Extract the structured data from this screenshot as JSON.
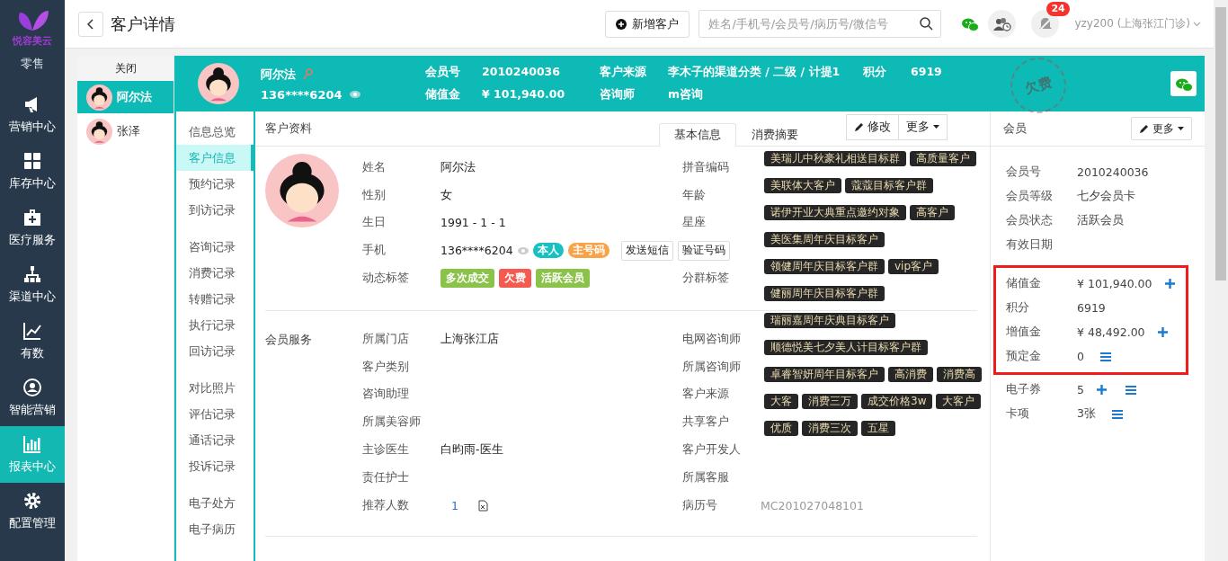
{
  "sidebar": {
    "logo": "悦容美云",
    "items": [
      {
        "label": "零售",
        "selected": false
      },
      {
        "label": "营销中心",
        "selected": false
      },
      {
        "label": "库存中心",
        "selected": false
      },
      {
        "label": "医疗服务",
        "selected": false
      },
      {
        "label": "渠道中心",
        "selected": false
      },
      {
        "label": "有数",
        "selected": false
      },
      {
        "label": "智能营销",
        "selected": false
      },
      {
        "label": "报表中心",
        "selected": true
      },
      {
        "label": "配置管理",
        "selected": false
      }
    ]
  },
  "header": {
    "title": "客户详情",
    "add_button": "新增客户",
    "search": {
      "placeholder": "姓名/手机号/会员号/病历号/微信号"
    },
    "notification_count": "24",
    "user": "yzy200 (上海张江门诊)"
  },
  "customer_tabs": {
    "close": "关闭",
    "items": [
      {
        "name": "阿尔法",
        "selected": true
      },
      {
        "name": "张泽",
        "selected": false
      }
    ]
  },
  "customer_header": {
    "name": "阿尔法",
    "phone": "136****6204",
    "stamp": "欠费",
    "fields": [
      {
        "label": "会员号",
        "value": "2010240036"
      },
      {
        "label": "客户来源",
        "value": "李木子的渠道分类 / 二级 / 计提1"
      },
      {
        "label": "积分",
        "value": "6919"
      },
      {
        "label": "储值金",
        "value": "¥ 101,940.00"
      },
      {
        "label": "咨询师",
        "value": "m咨询"
      }
    ]
  },
  "nav": {
    "groups": [
      [
        {
          "label": "信息总览",
          "selected": false
        },
        {
          "label": "客户信息",
          "selected": true
        },
        {
          "label": "预约记录",
          "selected": false
        },
        {
          "label": "到访记录",
          "selected": false
        }
      ],
      [
        {
          "label": "咨询记录",
          "selected": false
        },
        {
          "label": "消费记录",
          "selected": false
        },
        {
          "label": "转赠记录",
          "selected": false
        },
        {
          "label": "执行记录",
          "selected": false
        },
        {
          "label": "回访记录",
          "selected": false
        }
      ],
      [
        {
          "label": "对比照片",
          "selected": false
        },
        {
          "label": "评估记录",
          "selected": false
        },
        {
          "label": "通话记录",
          "selected": false
        },
        {
          "label": "投诉记录",
          "selected": false
        }
      ],
      [
        {
          "label": "电子处方",
          "selected": false
        },
        {
          "label": "电子病历",
          "selected": false
        }
      ]
    ]
  },
  "profile": {
    "title": "客户资料",
    "tabs": [
      {
        "label": "基本信息",
        "selected": true
      },
      {
        "label": "消费摘要",
        "selected": false
      }
    ],
    "edit_button": "修改",
    "more_button": "更多",
    "sections": [
      {
        "kind": "basic",
        "left": [
          {
            "label": "姓名",
            "kind": "text",
            "value": "阿尔法"
          },
          {
            "label": "性别",
            "kind": "text",
            "value": "女"
          },
          {
            "label": "生日",
            "kind": "text",
            "value": "1991 - 1 - 1"
          },
          {
            "label": "手机",
            "kind": "phone",
            "value": "136****6204",
            "tags": [
              {
                "text": "本人",
                "color": "#19c0c2"
              },
              {
                "text": "主号码",
                "color": "#f8a348"
              }
            ],
            "buttons": [
              "发送短信",
              "验证号码"
            ]
          },
          {
            "label": "动态标签",
            "kind": "tags",
            "tags": [
              {
                "text": "多次成交",
                "color": "#8bc34a"
              },
              {
                "text": "欠费",
                "color": "#f45b50"
              },
              {
                "text": "活跃会员",
                "color": "#8bc34a"
              }
            ]
          }
        ],
        "right": [
          {
            "label": "拼音编码",
            "kind": "text"
          },
          {
            "label": "年龄",
            "kind": "text"
          },
          {
            "label": "星座",
            "kind": "text"
          },
          {
            "label": "分群标签",
            "kind": "groups",
            "rows": [
              {
                "tags": [
                  "美瑞儿中秋豪礼相送目标群",
                  "高质量客户"
                ]
              },
              {
                "tags": [
                  "美联体大客户",
                  "蔻蔻目标客户群"
                ]
              },
              {
                "tags": [
                  "诺伊开业大典重点邀约对象",
                  "高客户"
                ]
              },
              {
                "tags": [
                  "美医集周年庆目标客户"
                ]
              },
              {
                "tags": [
                  "领健周年庆目标客户群",
                  "vip客户"
                ]
              },
              {
                "tags": [
                  "健丽周年庆目标客户群"
                ]
              },
              {
                "tags": [
                  "瑞丽嘉周年庆典目标客户"
                ]
              },
              {
                "tags": [
                  "顺德悦美七夕美人计目标客户群"
                ]
              },
              {
                "tags": [
                  "卓睿智妍周年目标客户",
                  "高消费",
                  "消费高"
                ]
              },
              {
                "tags": [
                  "大客",
                  "消费三万",
                  "成交价格3w",
                  "大客户"
                ]
              },
              {
                "tags": [
                  "优质",
                  "消费三次",
                  "五星"
                ]
              }
            ]
          }
        ]
      },
      {
        "kind": "service",
        "title": "会员服务",
        "left": [
          {
            "label": "所属门店",
            "kind": "text",
            "value": "上海张江店"
          },
          {
            "label": "客户类别",
            "kind": "text"
          },
          {
            "label": "咨询助理",
            "kind": "text"
          },
          {
            "label": "所属美容师",
            "kind": "text"
          },
          {
            "label": "主诊医生",
            "kind": "text",
            "value": "白昀雨-医生"
          },
          {
            "label": "责任护士",
            "kind": "text"
          },
          {
            "label": "推荐人数",
            "kind": "count",
            "value": "1"
          }
        ],
        "right": [
          {
            "label": "电网咨询师",
            "kind": "text"
          },
          {
            "label": "所属咨询师",
            "kind": "text"
          },
          {
            "label": "客户来源",
            "kind": "text"
          },
          {
            "label": "共享客户",
            "kind": "text"
          },
          {
            "label": "客户开发人",
            "kind": "text"
          },
          {
            "label": "所属客服",
            "kind": "text"
          },
          {
            "label": "病历号",
            "kind": "muted",
            "value": "MC201027048101"
          }
        ]
      }
    ]
  },
  "member": {
    "title": "会员",
    "more_button": "更多",
    "groups": [
      {
        "fields": [
          {
            "label": "会员号",
            "value": "2010240036"
          },
          {
            "label": "会员等级",
            "value": "七夕会员卡"
          },
          {
            "label": "会员状态",
            "value": "活跃会员"
          },
          {
            "label": "有效日期"
          }
        ]
      },
      {
        "highlighted": true,
        "fields": [
          {
            "label": "储值金",
            "value": "¥ 101,940.00",
            "add": true
          },
          {
            "label": "积分",
            "value": "6919"
          },
          {
            "label": "增值金",
            "value": "¥ 48,492.00",
            "add": true
          },
          {
            "label": "预定金",
            "value": "0",
            "list": true
          }
        ]
      },
      {
        "fields": [
          {
            "label": "电子券",
            "value": "5",
            "add": true,
            "list": true
          },
          {
            "label": "卡项",
            "value": "3张",
            "list": true
          }
        ]
      }
    ]
  }
}
